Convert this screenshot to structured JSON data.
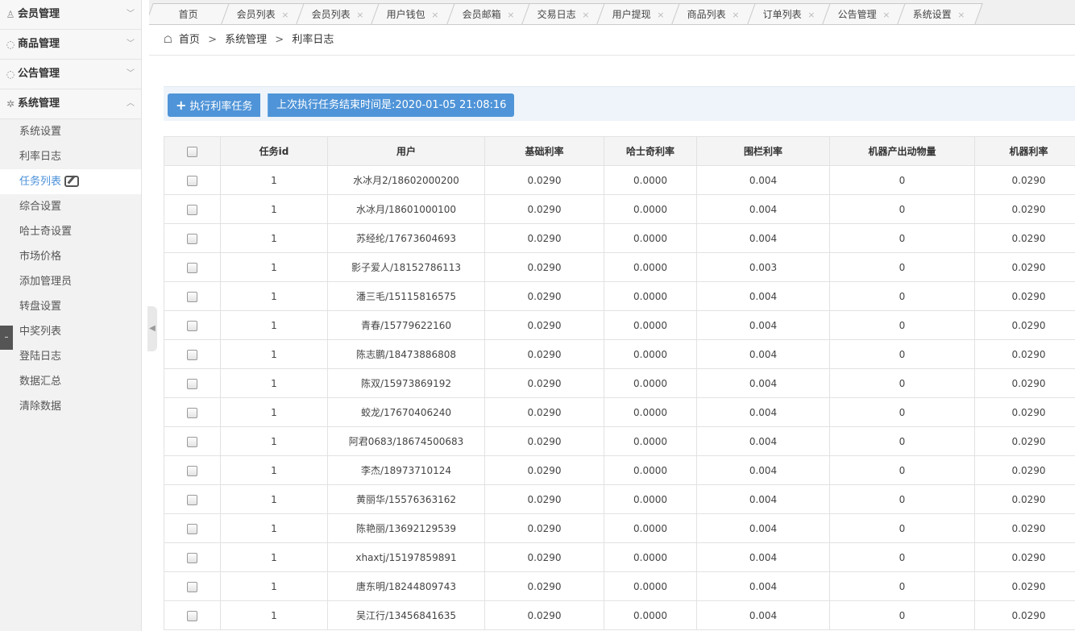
{
  "sidebar": {
    "groups": [
      {
        "label": "会员管理",
        "icon": "user-icon",
        "expanded": false
      },
      {
        "label": "商品管理",
        "icon": "circle-icon",
        "expanded": false
      },
      {
        "label": "公告管理",
        "icon": "circle-icon",
        "expanded": false
      },
      {
        "label": "系统管理",
        "icon": "gear-icon",
        "expanded": true
      }
    ],
    "sub_items": [
      "系统设置",
      "利率日志",
      "任务列表",
      "综合设置",
      "哈士奇设置",
      "市场价格",
      "添加管理员",
      "转盘设置",
      "中奖列表",
      "登陆日志",
      "数据汇总",
      "清除数据"
    ],
    "active_index": 2
  },
  "tabs": [
    {
      "label": "首页",
      "closable": false
    },
    {
      "label": "会员列表",
      "closable": true
    },
    {
      "label": "会员列表",
      "closable": true
    },
    {
      "label": "用户钱包",
      "closable": true
    },
    {
      "label": "会员邮箱",
      "closable": true
    },
    {
      "label": "交易日志",
      "closable": true
    },
    {
      "label": "用户提现",
      "closable": true
    },
    {
      "label": "商品列表",
      "closable": true
    },
    {
      "label": "订单列表",
      "closable": true
    },
    {
      "label": "公告管理",
      "closable": true
    },
    {
      "label": "系统设置",
      "closable": true
    }
  ],
  "breadcrumb": [
    "首页",
    "系统管理",
    "利率日志"
  ],
  "toolbar": {
    "run_label": "执行利率任务",
    "last_run_label": "上次执行任务结束时间是:2020-01-05 21:08:16"
  },
  "table": {
    "columns": [
      "任务id",
      "用户",
      "基础利率",
      "哈士奇利率",
      "围栏利率",
      "机器产出动物量",
      "机器利率"
    ],
    "rows": [
      [
        "1",
        "水冰月2/18602000200",
        "0.0290",
        "0.0000",
        "0.004",
        "0",
        "0.0290"
      ],
      [
        "1",
        "水冰月/18601000100",
        "0.0290",
        "0.0000",
        "0.004",
        "0",
        "0.0290"
      ],
      [
        "1",
        "苏经纶/17673604693",
        "0.0290",
        "0.0000",
        "0.004",
        "0",
        "0.0290"
      ],
      [
        "1",
        "影子爱人/18152786113",
        "0.0290",
        "0.0000",
        "0.003",
        "0",
        "0.0290"
      ],
      [
        "1",
        "潘三毛/15115816575",
        "0.0290",
        "0.0000",
        "0.004",
        "0",
        "0.0290"
      ],
      [
        "1",
        "青春/15779622160",
        "0.0290",
        "0.0000",
        "0.004",
        "0",
        "0.0290"
      ],
      [
        "1",
        "陈志鹏/18473886808",
        "0.0290",
        "0.0000",
        "0.004",
        "0",
        "0.0290"
      ],
      [
        "1",
        "陈双/15973869192",
        "0.0290",
        "0.0000",
        "0.004",
        "0",
        "0.0290"
      ],
      [
        "1",
        "蛟龙/17670406240",
        "0.0290",
        "0.0000",
        "0.004",
        "0",
        "0.0290"
      ],
      [
        "1",
        "阿君0683/18674500683",
        "0.0290",
        "0.0000",
        "0.004",
        "0",
        "0.0290"
      ],
      [
        "1",
        "李杰/18973710124",
        "0.0290",
        "0.0000",
        "0.004",
        "0",
        "0.0290"
      ],
      [
        "1",
        "黄丽华/15576363162",
        "0.0290",
        "0.0000",
        "0.004",
        "0",
        "0.0290"
      ],
      [
        "1",
        "陈艳丽/13692129539",
        "0.0290",
        "0.0000",
        "0.004",
        "0",
        "0.0290"
      ],
      [
        "1",
        "xhaxtj/15197859891",
        "0.0290",
        "0.0000",
        "0.004",
        "0",
        "0.0290"
      ],
      [
        "1",
        "唐东明/18244809743",
        "0.0290",
        "0.0000",
        "0.004",
        "0",
        "0.0290"
      ],
      [
        "1",
        "吴江行/13456841635",
        "0.0290",
        "0.0000",
        "0.004",
        "0",
        "0.0290"
      ]
    ]
  }
}
